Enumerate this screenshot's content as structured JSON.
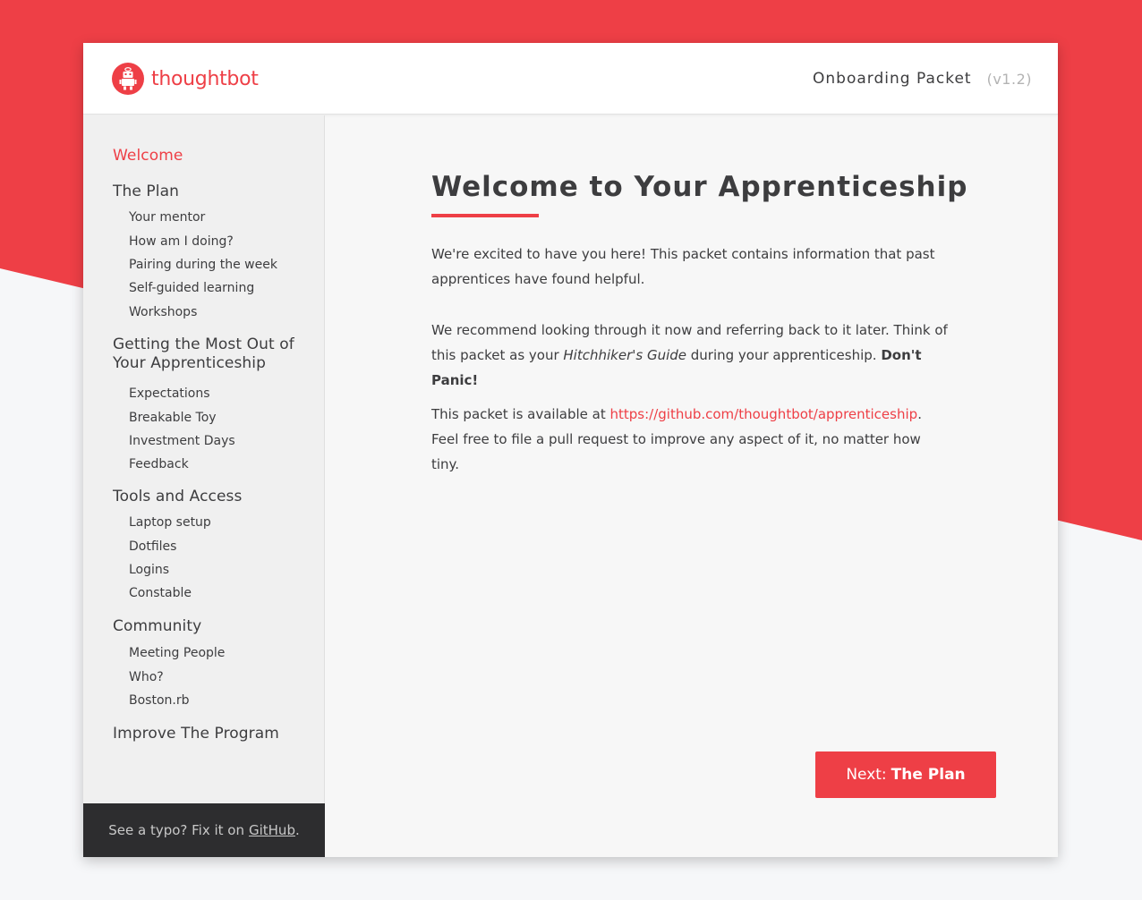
{
  "brand": {
    "name": "thoughtbot",
    "logo_icon": "robot-logo-icon",
    "color": "#ee3f46"
  },
  "header": {
    "title": "Onboarding Packet",
    "version": "(v1.2)"
  },
  "sidebar": {
    "sections": [
      {
        "label": "Welcome",
        "active": true,
        "items": []
      },
      {
        "label": "The Plan",
        "items": [
          "Your mentor",
          "How am I doing?",
          "Pairing during the week",
          "Self-guided learning",
          "Workshops"
        ]
      },
      {
        "label_lines": [
          "Getting the Most Out of",
          "Your Apprenticeship"
        ],
        "items": [
          "Expectations",
          "Breakable Toy",
          "Investment Days",
          "Feedback"
        ]
      },
      {
        "label": "Tools and Access",
        "items": [
          "Laptop setup",
          "Dotfiles",
          "Logins",
          "Constable"
        ]
      },
      {
        "label": "Community",
        "items": [
          "Meeting People",
          "Who?",
          "Boston.rb"
        ]
      },
      {
        "label": "Improve The Program",
        "items": []
      }
    ],
    "footer": {
      "text": "See a typo? Fix it on",
      "link_label": "GitHub",
      "suffix": "."
    }
  },
  "main": {
    "title": "Welcome to Your Apprenticeship",
    "paragraphs": {
      "p1": "We're excited to have you here! This packet contains information that past apprentices have found helpful.",
      "p2_before": "We recommend looking through it now and referring back to it later. Think of this packet as your ",
      "p2_em": "Hitchhiker's Guide",
      "p2_after": " during your apprenticeship. ",
      "p2_strong": "Don't Panic!",
      "p3_before": "This packet is available at ",
      "p3_link": "https://github.com/thoughtbot/apprenticeship",
      "p3_after": ". Feel free to file a pull request to improve any aspect of it, no matter how tiny."
    },
    "next_button": {
      "prefix": "Next:",
      "target": "The Plan"
    }
  },
  "colors": {
    "accent": "#ee3f46",
    "footer_bg": "#2d2d2f",
    "sidebar_bg": "#f0f0f0",
    "content_bg": "#f7f7f7"
  }
}
